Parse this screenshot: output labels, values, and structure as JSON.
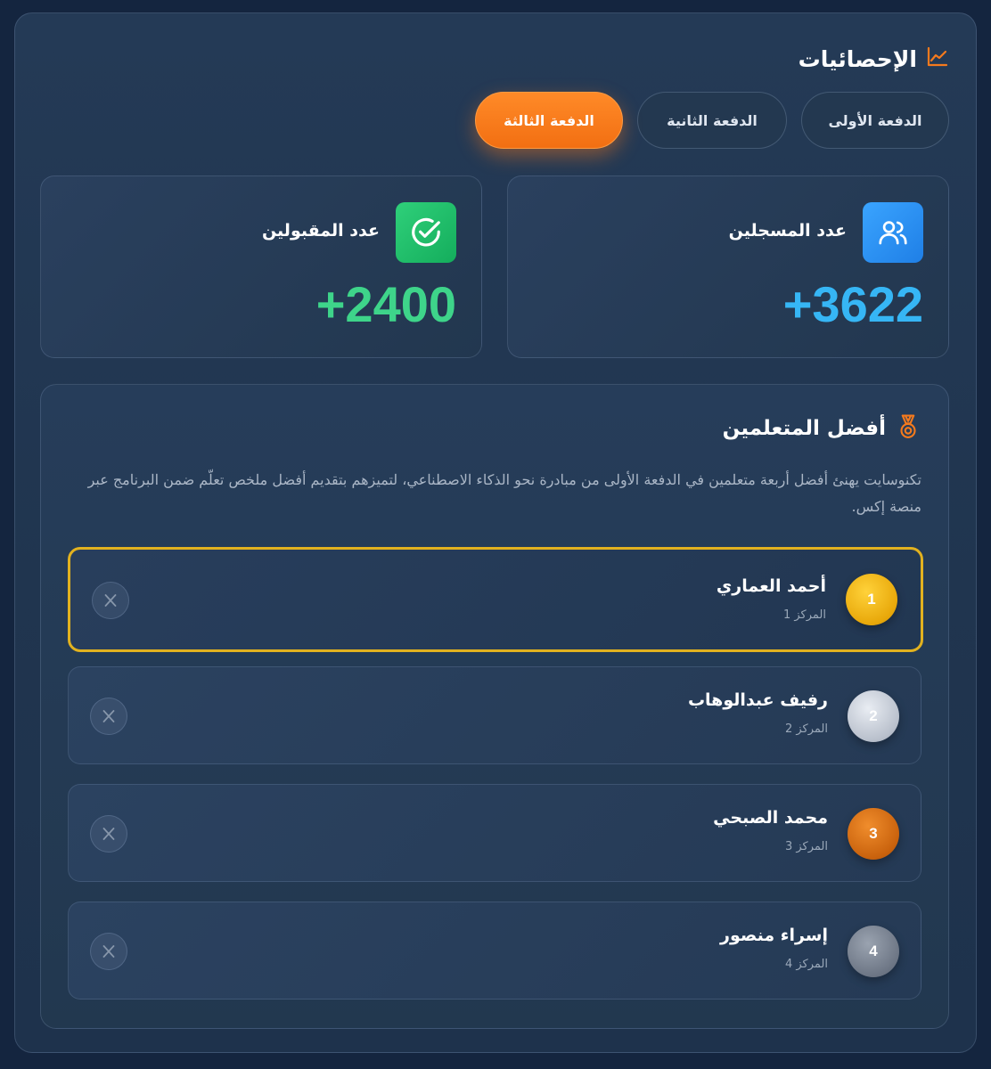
{
  "stats_section": {
    "title": "الإحصائيات",
    "icon": "line-chart-icon",
    "accent_color": "#f57a1d"
  },
  "tabs": [
    {
      "label": "الدفعة الأولى",
      "active": false
    },
    {
      "label": "الدفعة الثانية",
      "active": false
    },
    {
      "label": "الدفعة الثالثة",
      "active": true
    }
  ],
  "stats": {
    "registered": {
      "label": "عدد المسجلين",
      "value": "+3622",
      "icon": "users-icon",
      "color": "#36b6f5"
    },
    "accepted": {
      "label": "عدد المقبولين",
      "value": "+2400",
      "icon": "check-circle-icon",
      "color": "#3ed48a"
    }
  },
  "top_learners": {
    "title": "أفضل المتعلمين",
    "icon": "medal-icon",
    "description": "تكنوسايت يهنئ أفضل أربعة متعلمين في الدفعة الأولى من مبادرة نحو الذكاء الاصطناعي، لتميزهم بتقديم أفضل ملخص تعلّم ضمن البرنامج عبر منصة إكس.",
    "learners": [
      {
        "rank": "1",
        "name": "أحمد العماري",
        "position_label": "المركز 1",
        "badge": "gold",
        "highlight_color": "#e2b21f"
      },
      {
        "rank": "2",
        "name": "رفيف عبدالوهاب",
        "position_label": "المركز 2",
        "badge": "silver"
      },
      {
        "rank": "3",
        "name": "محمد الصبحي",
        "position_label": "المركز 3",
        "badge": "bronze"
      },
      {
        "rank": "4",
        "name": "إسراء منصور",
        "position_label": "المركز 4",
        "badge": "gray"
      }
    ],
    "social_icon": "x-logo-icon"
  }
}
